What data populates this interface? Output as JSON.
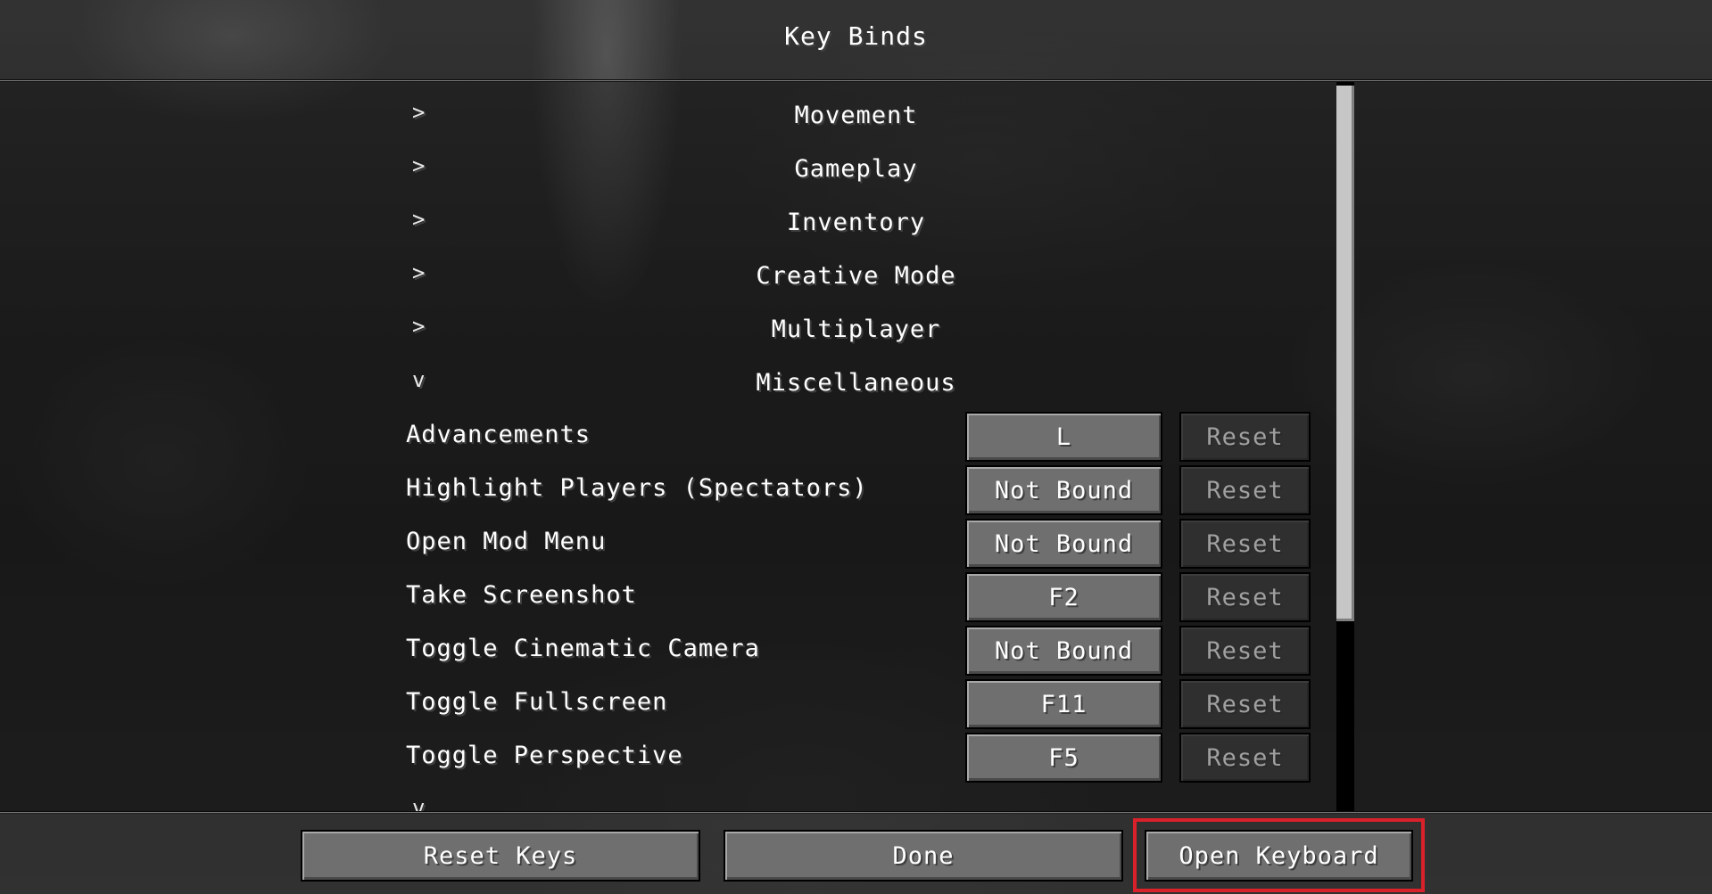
{
  "title": "Key Binds",
  "categories": [
    {
      "chevron": ">",
      "label": "Movement",
      "expanded": false
    },
    {
      "chevron": ">",
      "label": "Gameplay",
      "expanded": false
    },
    {
      "chevron": ">",
      "label": "Inventory",
      "expanded": false
    },
    {
      "chevron": ">",
      "label": "Creative Mode",
      "expanded": false
    },
    {
      "chevron": ">",
      "label": "Multiplayer",
      "expanded": false
    },
    {
      "chevron": "v",
      "label": "Miscellaneous",
      "expanded": true
    }
  ],
  "bindings": [
    {
      "name": "Advancements",
      "key": "L",
      "reset": "Reset"
    },
    {
      "name": "Highlight Players (Spectators)",
      "key": "Not Bound",
      "reset": "Reset"
    },
    {
      "name": "Open Mod Menu",
      "key": "Not Bound",
      "reset": "Reset"
    },
    {
      "name": "Take Screenshot",
      "key": "F2",
      "reset": "Reset"
    },
    {
      "name": "Toggle Cinematic Camera",
      "key": "Not Bound",
      "reset": "Reset"
    },
    {
      "name": "Toggle Fullscreen",
      "key": "F11",
      "reset": "Reset"
    },
    {
      "name": "Toggle Perspective",
      "key": "F5",
      "reset": "Reset"
    }
  ],
  "partial": {
    "chevron": "v"
  },
  "footer": {
    "reset_keys": "Reset Keys",
    "done": "Done",
    "open_keyboard": "Open Keyboard"
  },
  "colors": {
    "highlight": "#d9212b",
    "button": "#6f6f6f",
    "button_disabled": "#2f2f2f"
  }
}
